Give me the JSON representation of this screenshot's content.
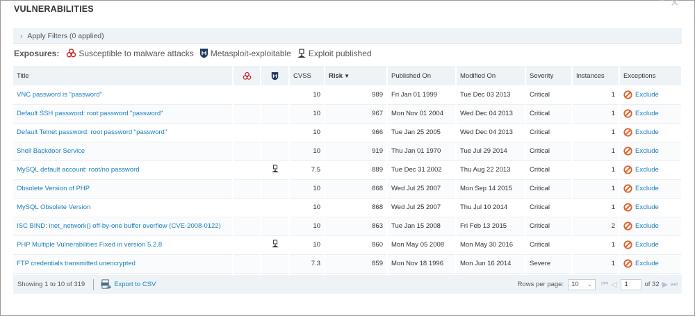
{
  "window": {
    "title": "VULNERABILITIES"
  },
  "filters": {
    "label": "Apply Filters (0 applied)"
  },
  "exposures": {
    "label": "Exposures:",
    "items": [
      {
        "icon": "biohazard-icon",
        "label": "Susceptible to malware attacks"
      },
      {
        "icon": "metasploit-icon",
        "label": "Metasploit-exploitable"
      },
      {
        "icon": "exploit-published-icon",
        "label": "Exploit published"
      }
    ]
  },
  "columns": {
    "title": "Title",
    "cvss": "CVSS",
    "risk": "Risk",
    "published": "Published On",
    "modified": "Modified On",
    "severity": "Severity",
    "instances": "Instances",
    "exceptions": "Exceptions"
  },
  "rows": [
    {
      "title": "VNC password is \"password\"",
      "exploit": false,
      "cvss": "10",
      "risk": "989",
      "published": "Fri Jan 01 1999",
      "modified": "Tue Dec 03 2013",
      "severity": "Critical",
      "instances": "1",
      "exception": "Exclude"
    },
    {
      "title": "Default SSH password: root password \"password\"",
      "exploit": false,
      "cvss": "10",
      "risk": "967",
      "published": "Mon Nov 01 2004",
      "modified": "Wed Dec 04 2013",
      "severity": "Critical",
      "instances": "1",
      "exception": "Exclude"
    },
    {
      "title": "Default Telnet password: root password \"password\"",
      "exploit": false,
      "cvss": "10",
      "risk": "966",
      "published": "Tue Jan 25 2005",
      "modified": "Wed Dec 04 2013",
      "severity": "Critical",
      "instances": "1",
      "exception": "Exclude"
    },
    {
      "title": "Shell Backdoor Service",
      "exploit": false,
      "cvss": "10",
      "risk": "919",
      "published": "Thu Jan 01 1970",
      "modified": "Tue Jul 29 2014",
      "severity": "Critical",
      "instances": "1",
      "exception": "Exclude"
    },
    {
      "title": "MySQL default account: root/no password",
      "exploit": true,
      "cvss": "7.5",
      "risk": "889",
      "published": "Tue Dec 31 2002",
      "modified": "Thu Aug 22 2013",
      "severity": "Critical",
      "instances": "1",
      "exception": "Exclude"
    },
    {
      "title": "Obsolete Version of PHP",
      "exploit": false,
      "cvss": "10",
      "risk": "868",
      "published": "Wed Jul 25 2007",
      "modified": "Mon Sep 14 2015",
      "severity": "Critical",
      "instances": "1",
      "exception": "Exclude"
    },
    {
      "title": "MySQL Obsolete Version",
      "exploit": false,
      "cvss": "10",
      "risk": "868",
      "published": "Wed Jul 25 2007",
      "modified": "Thu Jul 10 2014",
      "severity": "Critical",
      "instances": "1",
      "exception": "Exclude"
    },
    {
      "title": "ISC BIND: inet_network() off-by-one buffer overflow (CVE-2008-0122)",
      "exploit": false,
      "cvss": "10",
      "risk": "863",
      "published": "Tue Jan 15 2008",
      "modified": "Fri Feb 13 2015",
      "severity": "Critical",
      "instances": "2",
      "exception": "Exclude"
    },
    {
      "title": "PHP Multiple Vulnerabilities Fixed in version 5.2.8",
      "exploit": true,
      "cvss": "10",
      "risk": "860",
      "published": "Mon May 05 2008",
      "modified": "Mon May 30 2016",
      "severity": "Critical",
      "instances": "1",
      "exception": "Exclude"
    },
    {
      "title": "FTP credentials transmitted unencrypted",
      "exploit": false,
      "cvss": "7.3",
      "risk": "859",
      "published": "Mon Nov 18 1996",
      "modified": "Mon Jun 16 2014",
      "severity": "Severe",
      "instances": "1",
      "exception": "Exclude"
    }
  ],
  "footer": {
    "showing": "Showing 1 to 10 of 319",
    "export": "Export to CSV",
    "rows_per_page_label": "Rows per page:",
    "rows_per_page": "10",
    "page": "1",
    "of_pages": "of 32"
  },
  "colors": {
    "link": "#1a7fbe",
    "header_bg": "#eef3f8",
    "exclude_icon": "#e0622a",
    "biohazard": "#c0282e",
    "metasploit": "#1e3a5c"
  }
}
